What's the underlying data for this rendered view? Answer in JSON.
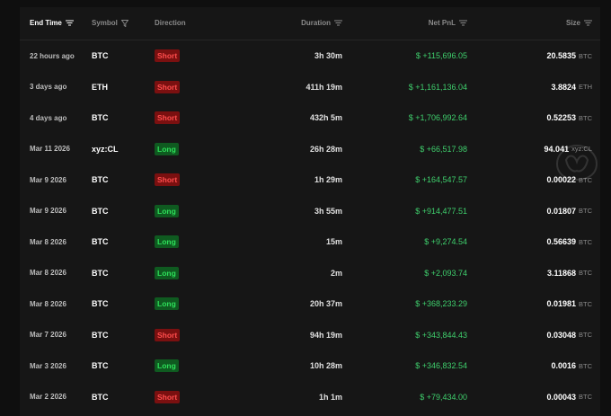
{
  "colors": {
    "background": "#161616",
    "pnl_positive": "#3fd06d",
    "short_bg": "#7a1010",
    "short_text": "#ff4d4d",
    "long_bg": "#0f5a20",
    "long_text": "#2ee05a"
  },
  "header": {
    "end_time": "End Time",
    "symbol": "Symbol",
    "direction": "Direction",
    "duration": "Duration",
    "net_pnl": "Net PnL",
    "size": "Size"
  },
  "rows": [
    {
      "time": "22 hours ago",
      "symbol": "BTC",
      "direction": "Short",
      "duration": "3h 30m",
      "pnl": "$ +115,696.05",
      "size": "20.5835",
      "unit": "BTC"
    },
    {
      "time": "3 days ago",
      "symbol": "ETH",
      "direction": "Short",
      "duration": "411h 19m",
      "pnl": "$ +1,161,136.04",
      "size": "3.8824",
      "unit": "ETH"
    },
    {
      "time": "4 days ago",
      "symbol": "BTC",
      "direction": "Short",
      "duration": "432h 5m",
      "pnl": "$ +1,706,992.64",
      "size": "0.52253",
      "unit": "BTC"
    },
    {
      "time": "Mar 11 2026",
      "symbol": "xyz:CL",
      "direction": "Long",
      "duration": "26h 28m",
      "pnl": "$ +66,517.98",
      "size": "94.041",
      "unit": "xyz:CL"
    },
    {
      "time": "Mar 9 2026",
      "symbol": "BTC",
      "direction": "Short",
      "duration": "1h 29m",
      "pnl": "$ +164,547.57",
      "size": "0.00022",
      "unit": "BTC"
    },
    {
      "time": "Mar 9 2026",
      "symbol": "BTC",
      "direction": "Long",
      "duration": "3h 55m",
      "pnl": "$ +914,477.51",
      "size": "0.01807",
      "unit": "BTC"
    },
    {
      "time": "Mar 8 2026",
      "symbol": "BTC",
      "direction": "Long",
      "duration": "15m",
      "pnl": "$ +9,274.54",
      "size": "0.56639",
      "unit": "BTC"
    },
    {
      "time": "Mar 8 2026",
      "symbol": "BTC",
      "direction": "Long",
      "duration": "2m",
      "pnl": "$ +2,093.74",
      "size": "3.11868",
      "unit": "BTC"
    },
    {
      "time": "Mar 8 2026",
      "symbol": "BTC",
      "direction": "Long",
      "duration": "20h 37m",
      "pnl": "$ +368,233.29",
      "size": "0.01981",
      "unit": "BTC"
    },
    {
      "time": "Mar 7 2026",
      "symbol": "BTC",
      "direction": "Short",
      "duration": "94h 19m",
      "pnl": "$ +343,844.43",
      "size": "0.03048",
      "unit": "BTC"
    },
    {
      "time": "Mar 3 2026",
      "symbol": "BTC",
      "direction": "Long",
      "duration": "10h 28m",
      "pnl": "$ +346,832.54",
      "size": "0.0016",
      "unit": "BTC"
    },
    {
      "time": "Mar 2 2026",
      "symbol": "BTC",
      "direction": "Short",
      "duration": "1h 1m",
      "pnl": "$ +79,434.00",
      "size": "0.00043",
      "unit": "BTC"
    }
  ]
}
